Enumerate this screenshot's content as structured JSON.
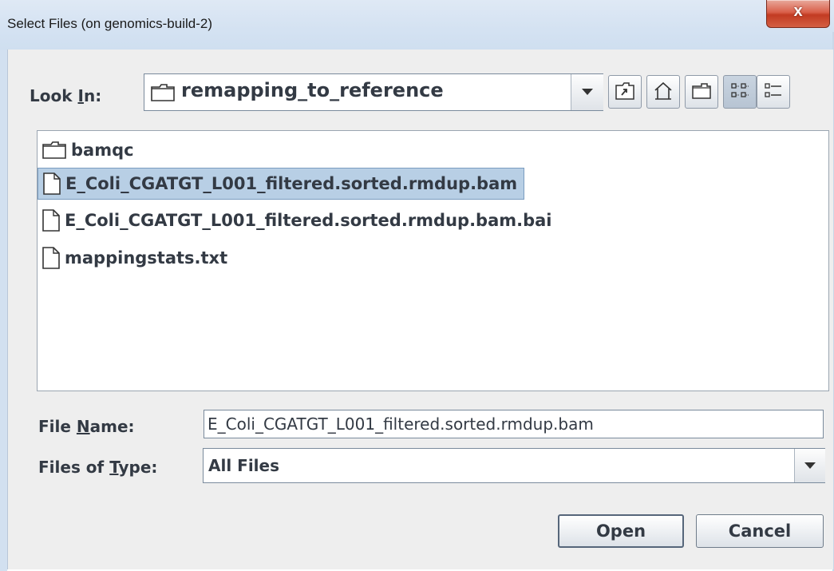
{
  "window": {
    "title": "Select Files (on genomics-build-2)",
    "close_label": "x"
  },
  "look_in": {
    "label_prefix": "Look ",
    "label_mnemonic": "I",
    "label_suffix": "n:",
    "value": "remapping_to_reference"
  },
  "toolbar": {
    "buttons": [
      "up-one-level-icon",
      "home-icon",
      "new-folder-icon",
      "list-view-icon",
      "details-view-icon"
    ]
  },
  "files": [
    {
      "name": "bamqc",
      "type": "folder",
      "selected": false
    },
    {
      "name": "E_Coli_CGATGT_L001_filtered.sorted.rmdup.bam",
      "type": "file",
      "selected": true
    },
    {
      "name": "E_Coli_CGATGT_L001_filtered.sorted.rmdup.bam.bai",
      "type": "file",
      "selected": false
    },
    {
      "name": "mappingstats.txt",
      "type": "file",
      "selected": false
    }
  ],
  "file_name": {
    "label_prefix": "File ",
    "label_mnemonic": "N",
    "label_suffix": "ame:",
    "value": "E_Coli_CGATGT_L001_filtered.sorted.rmdup.bam"
  },
  "file_type": {
    "label_prefix": "Files of ",
    "label_mnemonic": "T",
    "label_suffix": "ype:",
    "value": "All Files"
  },
  "actions": {
    "open_label": "Open",
    "cancel_label": "Cancel"
  },
  "colors": {
    "selection": "#b8cfe5",
    "close_button": "#c23b22"
  }
}
